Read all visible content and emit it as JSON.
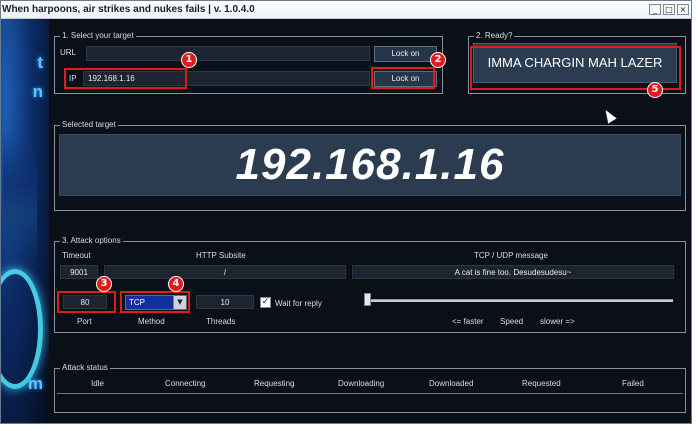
{
  "window": {
    "title": "When harpoons, air strikes and nukes fails | v. 1.0.4.0",
    "controls": [
      "_",
      "□",
      "×"
    ]
  },
  "left_art": {
    "letters": [
      "t",
      "n",
      "m"
    ]
  },
  "select_target": {
    "group_label": "1. Select your target",
    "url_label": "URL",
    "url_value": "",
    "ip_label": "IP",
    "ip_value": "192.168.1.16",
    "url_lock_button": "Lock on",
    "ip_lock_button": "Lock on"
  },
  "ready": {
    "group_label": "2. Ready?",
    "fire_button": "IMMA CHARGIN MAH LAZER"
  },
  "selected_target": {
    "group_label": "Selected target",
    "value": "192.168.1.16"
  },
  "attack_options": {
    "group_label": "3. Attack options",
    "timeout_label": "Timeout",
    "timeout_value": "9001",
    "http_subsite_label": "HTTP Subsite",
    "http_subsite_value": "/",
    "message_label": "TCP / UDP message",
    "message_value": "A cat is fine too. Desudesudesu~",
    "port_value": "80",
    "port_label": "Port",
    "method_value": "TCP",
    "method_label": "Method",
    "threads_value": "10",
    "threads_label": "Threads",
    "wait_for_reply_label": "Wait for reply",
    "wait_for_reply_checked": true,
    "speed_faster": "<= faster",
    "speed_label": "Speed",
    "speed_slower": "slower =>",
    "speed_level": 0
  },
  "attack_status": {
    "group_label": "Attack status",
    "columns": [
      "Idle",
      "Connecting",
      "Requesting",
      "Downloading",
      "Downloaded",
      "Requested",
      "Failed"
    ]
  },
  "annotations": [
    "1",
    "2",
    "3",
    "4",
    "5"
  ],
  "colors": {
    "highlight": "#e01b1b",
    "panel": "#2b3b50",
    "background": "#0a0f18"
  }
}
